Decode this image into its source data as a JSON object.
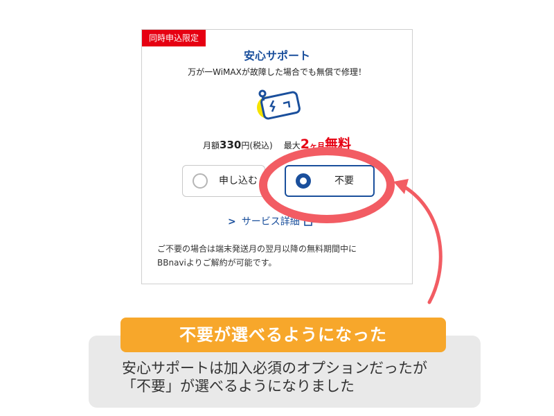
{
  "badge": "同時申込限定",
  "title": "安心サポート",
  "subtitle": "万が一WiMAXが故障した場合でも無償で修理！",
  "illustration": "broken-device-icon",
  "price": {
    "prefix": "月額",
    "amount": "330",
    "unit": "円(税込)",
    "max_label": "最大",
    "months_num": "2",
    "months_unit": "ヶ月",
    "free_label": "無料"
  },
  "options": [
    {
      "label": "申し込む",
      "selected": false
    },
    {
      "label": "不要",
      "selected": true
    }
  ],
  "service_detail": "サービス詳細",
  "note_lines": [
    "ご不要の場合は端末発送月の翌月以降の無料期間中に",
    "BBnaviよりご解約が可能です。"
  ],
  "callout_heading": "不要が選べるようになった",
  "callout_lines": [
    "安心サポートは加入必須のオプションだったが",
    "「不要」が選べるようになりました"
  ],
  "colors": {
    "badge_red": "#e60012",
    "brand_blue": "#1a4f9c",
    "highlight": "#f25c63",
    "orange": "#f7a72b",
    "gray_box": "#e9e9e9"
  }
}
